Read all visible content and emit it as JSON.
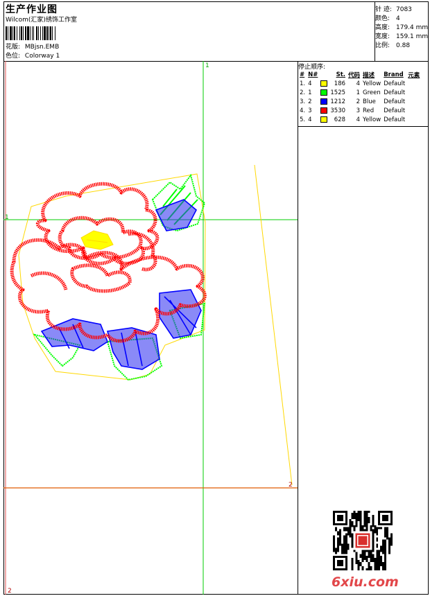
{
  "header": {
    "title": "生产作业图",
    "company": "Wilcom(汇家)绣饰工作室",
    "design_label": "花版:",
    "design_value": "MBjsn.EMB",
    "colorway_label": "色位:",
    "colorway_value": "Colorway 1"
  },
  "info": [
    {
      "label": "针 迹:",
      "value": "7083"
    },
    {
      "label": "颜色:",
      "value": "4"
    },
    {
      "label": "高度:",
      "value": "179.4 mm"
    },
    {
      "label": "宽度:",
      "value": "159.1 mm"
    },
    {
      "label": "比例:",
      "value": "0.88"
    }
  ],
  "stop_sequence": {
    "title": "停止顺序:",
    "headers": [
      "#",
      "N#",
      "St.",
      "代码",
      "描述",
      "Brand",
      "元素"
    ],
    "rows": [
      {
        "idx": "1.",
        "n": "4",
        "color": "#ffff00",
        "st": "186",
        "code": "4",
        "desc": "Yellow",
        "brand": "Default"
      },
      {
        "idx": "2.",
        "n": "1",
        "color": "#00ff00",
        "st": "1525",
        "code": "1",
        "desc": "Green",
        "brand": "Default"
      },
      {
        "idx": "3.",
        "n": "2",
        "color": "#0000ff",
        "st": "1212",
        "code": "2",
        "desc": "Blue",
        "brand": "Default"
      },
      {
        "idx": "4.",
        "n": "3",
        "color": "#ff0000",
        "st": "3530",
        "code": "3",
        "desc": "Red",
        "brand": "Default"
      },
      {
        "idx": "5.",
        "n": "4",
        "color": "#ffff00",
        "st": "628",
        "code": "4",
        "desc": "Yellow",
        "brand": "Default"
      }
    ]
  },
  "markers": {
    "top": "1",
    "left": "1",
    "right": "2",
    "bottom": "2"
  },
  "watermark": "6xiu.com",
  "colors": {
    "guide_green": "#00cc00",
    "guide_orange": "#e05a00",
    "outline_yellow": "#ffd800",
    "thread_red": "#ff0000",
    "thread_green": "#00ff00",
    "thread_blue": "#0000ff",
    "thread_yellow": "#ffff00"
  }
}
